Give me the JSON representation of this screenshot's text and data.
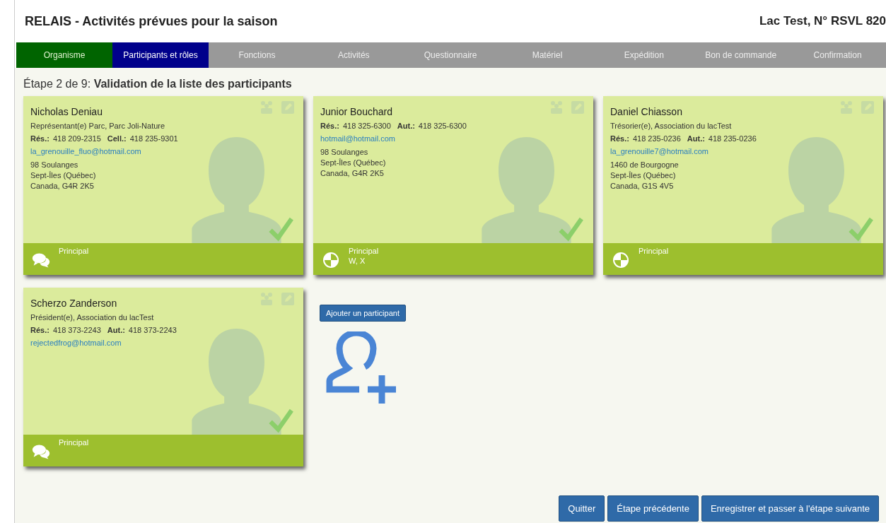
{
  "header": {
    "title": "RELAIS - Activités prévues pour la saison",
    "lake": "Lac Test, N° RSVL 820"
  },
  "tabs": [
    {
      "label": "Organisme",
      "selected": false,
      "completed": true
    },
    {
      "label": "Participants et rôles",
      "selected": true,
      "completed": false
    },
    {
      "label": "Fonctions",
      "selected": false,
      "completed": false
    },
    {
      "label": "Activités",
      "selected": false,
      "completed": false
    },
    {
      "label": "Questionnaire",
      "selected": false,
      "completed": false
    },
    {
      "label": "Matériel",
      "selected": false,
      "completed": false
    },
    {
      "label": "Expédition",
      "selected": false,
      "completed": false
    },
    {
      "label": "Bon de commande",
      "selected": false,
      "completed": false
    },
    {
      "label": "Confirmation",
      "selected": false,
      "completed": false
    }
  ],
  "step": {
    "prefix": "Étape 2 de 9:",
    "title": "Validation de la liste des participants"
  },
  "participants": [
    {
      "name": "Nicholas Deniau",
      "role": "Représentant(e) Parc, Parc Joli-Nature",
      "phones": [
        {
          "label": "Rés.:",
          "number": "418 209-2315"
        },
        {
          "label": "Cell.:",
          "number": "418 235-9301"
        }
      ],
      "email": "la_grenouille_fluo@hotmail.com",
      "address": [
        "98 Soulanges",
        "Sept-Îles (Québec)",
        "Canada, G4R 2K5"
      ],
      "validated": true,
      "kind": "chat",
      "footer": [
        "Principal"
      ]
    },
    {
      "name": "Junior Bouchard",
      "phones": [
        {
          "label": "Rés.:",
          "number": "418 325-6300"
        },
        {
          "label": "Aut.:",
          "number": "418 325-6300"
        }
      ],
      "email": "hotmail@hotmail.com",
      "address": [
        "98 Soulanges",
        "Sept-Îles (Québec)",
        "Canada, G4R 2K5"
      ],
      "validated": true,
      "kind": "quadrant",
      "footer": [
        "Principal",
        "W, X"
      ]
    },
    {
      "name": "Daniel Chiasson",
      "role": "Trésorier(e), Association du lacTest",
      "phones": [
        {
          "label": "Rés.:",
          "number": "418 235-0236"
        },
        {
          "label": "Aut.:",
          "number": "418 235-0236"
        }
      ],
      "email": "la_grenouille7@hotmail.com",
      "address": [
        "1460 de Bourgogne",
        "Sept-Îles (Québec)",
        "Canada, G1S 4V5"
      ],
      "validated": true,
      "kind": "quadrant",
      "footer": [
        "Principal"
      ]
    },
    {
      "name": "Scherzo Zanderson",
      "role": "Président(e), Association du lacTest",
      "phones": [
        {
          "label": "Rés.:",
          "number": "418 373-2243"
        },
        {
          "label": "Aut.:",
          "number": "418 373-2243"
        }
      ],
      "email": "rejectedfrog@hotmail.com",
      "validated": true,
      "kind": "chat",
      "footer": [
        "Principal"
      ]
    }
  ],
  "add_button": "Ajouter un participant",
  "buttons": [
    "Quitter",
    "Étape précédente",
    "Enregistrer et passer à l'étape suivante"
  ]
}
